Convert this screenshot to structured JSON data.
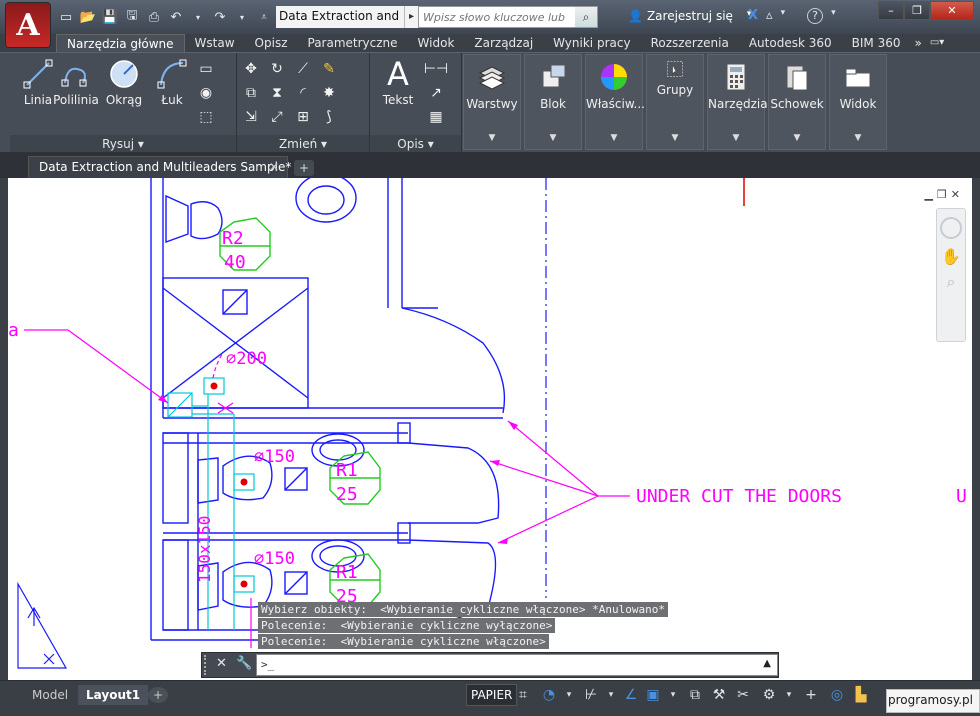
{
  "app": {
    "logo_letter": "A",
    "title": "Data Extraction and M...",
    "search_placeholder": "Wpisz słowo kluczowe lub frazę",
    "signin": "Zarejestruj się"
  },
  "ribbon_tabs": [
    "Narzędzia główne",
    "Wstaw",
    "Opisz",
    "Parametryczne",
    "Widok",
    "Zarządzaj",
    "Wyniki pracy",
    "Rozszerzenia",
    "Autodesk 360",
    "BIM 360"
  ],
  "draw_panel": {
    "title": "Rysuj",
    "tools": [
      "Linia",
      "Polilinia",
      "Okrąg",
      "Łuk"
    ]
  },
  "modify_panel": {
    "title": "Zmień"
  },
  "annotate_panel": {
    "title": "Opis",
    "text_tool": "Tekst"
  },
  "big_tools": [
    "Warstwy",
    "Blok",
    "Właściw...",
    "Grupy",
    "Narzędzia",
    "Schowek",
    "Widok"
  ],
  "document_tab": "Data Extraction and Multileaders Sample*",
  "drawing": {
    "note": "UNDER CUT THE DOORS",
    "note_cut": "U",
    "left_cut": "a",
    "r2_top": "R2",
    "r2_bottom": "40",
    "r1a_top": "R1",
    "r1a_bottom": "25",
    "r1b_top": "R1",
    "r1b_bottom": "25",
    "dia200": "⌀200",
    "dia150a": "⌀150",
    "dia150b": "⌀150",
    "duct": "150x150"
  },
  "command_history": [
    "Wybierz obiekty:  <Wybieranie cykliczne włączone> *Anulowano*",
    "Polecenie:  <Wybieranie cykliczne wyłączone>",
    "Polecenie:  <Wybieranie cykliczne włączone>"
  ],
  "command_prompt": ">_",
  "status": {
    "layout_tabs": [
      "Model",
      "Layout1"
    ],
    "paper": "PAPIER",
    "brand": "programosy.pl"
  }
}
